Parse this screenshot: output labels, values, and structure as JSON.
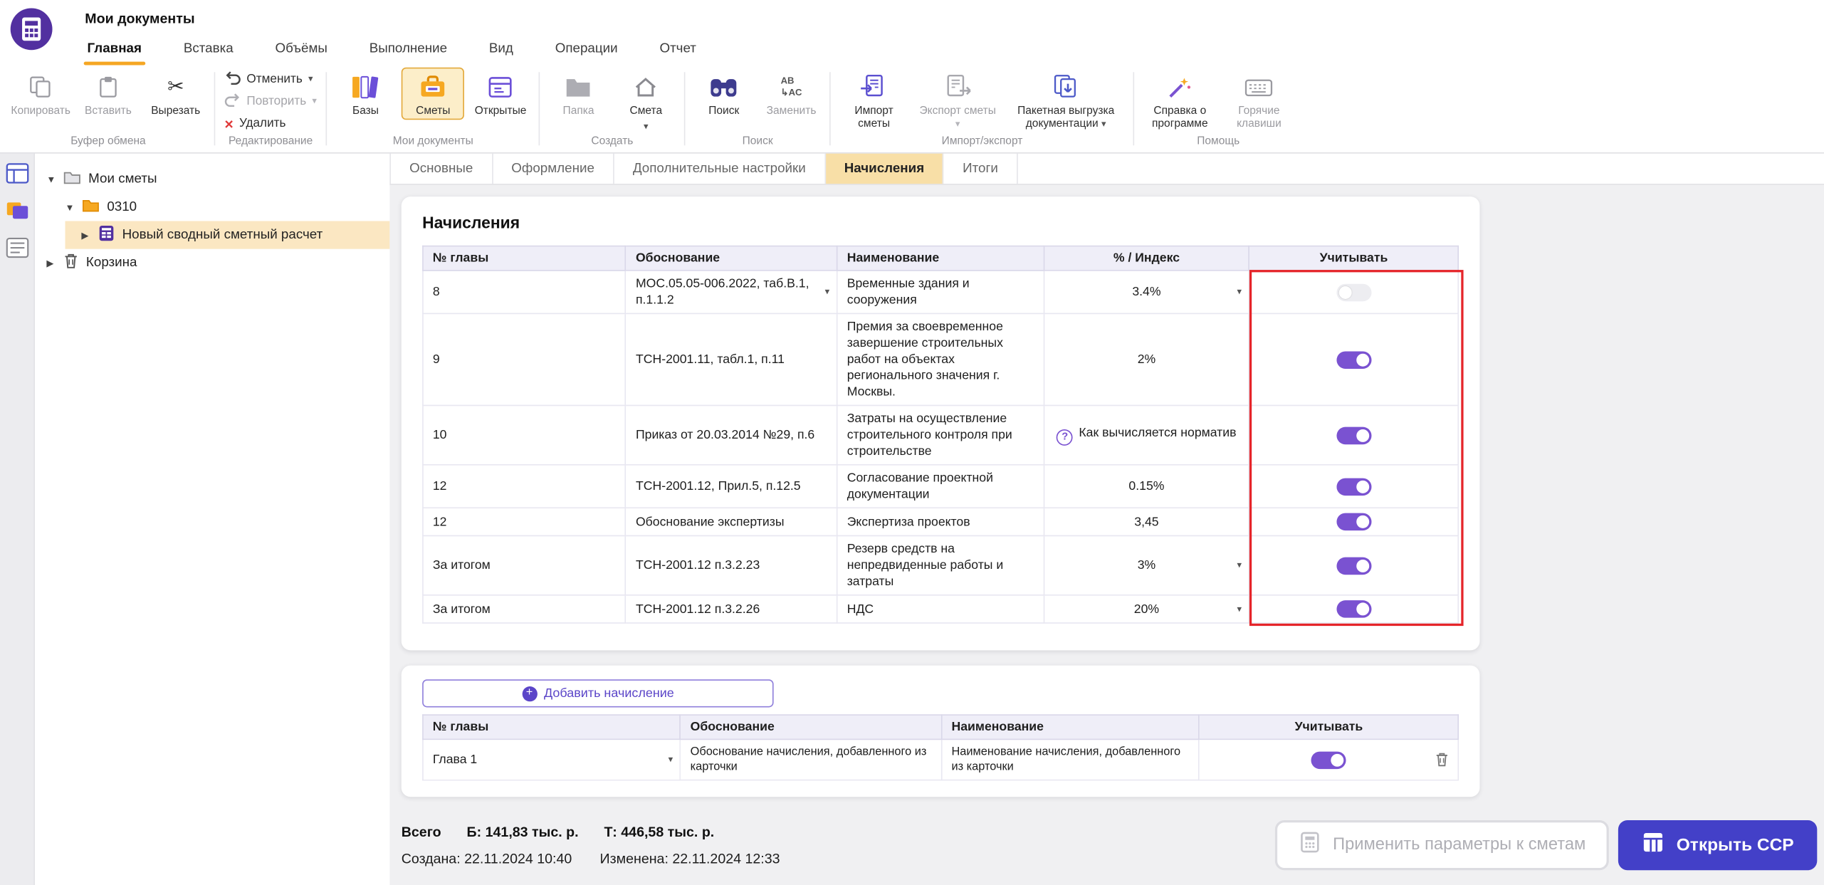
{
  "colors": {
    "accent_purple": "#7A52D1",
    "primary_button": "#4340C8",
    "active_tab_bg": "#F8DFA7",
    "orange_accent": "#F5A623",
    "red_outline": "#E5252A"
  },
  "header": {
    "app_title": "Мои документы",
    "tabs": [
      {
        "label": "Главная",
        "active": true
      },
      {
        "label": "Вставка"
      },
      {
        "label": "Объёмы"
      },
      {
        "label": "Выполнение"
      },
      {
        "label": "Вид"
      },
      {
        "label": "Операции"
      },
      {
        "label": "Отчет"
      }
    ]
  },
  "ribbon": {
    "clipboard": {
      "label": "Буфер обмена",
      "copy": "Копировать",
      "paste": "Вставить",
      "cut": "Вырезать"
    },
    "editing": {
      "label": "Редактирование",
      "undo": "Отменить",
      "redo": "Повторить",
      "delete": "Удалить"
    },
    "documents": {
      "label": "Мои документы",
      "bases": "Базы",
      "estimates": "Сметы",
      "open": "Открытые"
    },
    "create": {
      "label": "Создать",
      "folder": "Папка",
      "estimate": "Смета"
    },
    "search": {
      "label": "Поиск",
      "find": "Поиск",
      "replace": "Заменить"
    },
    "import_export": {
      "label": "Импорт/экспорт",
      "import": "Импорт сметы",
      "export": "Экспорт сметы",
      "batch": "Пакетная выгрузка документации"
    },
    "help": {
      "label": "Помощь",
      "about": "Справка о программе",
      "hotkeys": "Горячие клавиши"
    }
  },
  "tree": {
    "root": "Мои сметы",
    "folder": "0310",
    "selected_item": "Новый сводный сметный расчет",
    "trash": "Корзина"
  },
  "content_tabs": [
    {
      "label": "Основные"
    },
    {
      "label": "Оформление"
    },
    {
      "label": "Дополнительные настройки"
    },
    {
      "label": "Начисления",
      "active": true
    },
    {
      "label": "Итоги"
    }
  ],
  "accruals": {
    "title": "Начисления",
    "columns": {
      "chapter": "№ главы",
      "basis": "Обоснование",
      "name": "Наименование",
      "index": "% / Индекс",
      "consider": "Учитывать"
    },
    "rows": [
      {
        "chapter": "8",
        "basis": "МОС.05.05-006.2022, таб.В.1, п.1.1.2",
        "name": "Временные здания и сооружения",
        "index": "3.4%",
        "enabled": false
      },
      {
        "chapter": "9",
        "basis": "ТСН-2001.11, табл.1, п.11",
        "name": "Премия за своевременное завершение строительных работ на объектах регионального значения г. Москвы.",
        "index": "2%",
        "enabled": true
      },
      {
        "chapter": "10",
        "basis": "Приказ от 20.03.2014 №29, п.6",
        "name": "Затраты на осуществление строительного контроля при строительстве",
        "index": "Как вычисляется норматив",
        "enabled": true
      },
      {
        "chapter": "12",
        "basis": "ТСН-2001.12, Прил.5, п.12.5",
        "name": "Согласование проектной документации",
        "index": "0.15%",
        "enabled": true
      },
      {
        "chapter": "12",
        "basis": "Обоснование экспертизы",
        "name": "Экспертиза проектов",
        "index": "3,45",
        "enabled": true
      },
      {
        "chapter": "За итогом",
        "basis": "ТСН-2001.12 п.3.2.23",
        "name": "Резерв средств на непредвиденные работы и затраты",
        "index": "3%",
        "enabled": true
      },
      {
        "chapter": "За итогом",
        "basis": "ТСН-2001.12 п.3.2.26",
        "name": "НДС",
        "index": "20%",
        "enabled": true
      }
    ]
  },
  "add_accrual": {
    "button": "Добавить начисление",
    "columns": {
      "chapter": "№ главы",
      "basis": "Обоснование",
      "name": "Наименование",
      "consider": "Учитывать"
    },
    "row": {
      "chapter": "Глава 1",
      "basis": "Обоснование начисления, добавленного из карточки",
      "name": "Наименование начисления, добавленного из карточки",
      "enabled": true
    }
  },
  "status": {
    "total_label": "Всего",
    "base_value": "Б: 141,83 тыс. р.",
    "current_value": "Т: 446,58 тыс. р.",
    "created": "Создана: 22.11.2024 10:40",
    "modified": "Изменена: 22.11.2024 12:33",
    "apply_button": "Применить параметры к сметам",
    "open_button": "Открыть ССР"
  }
}
